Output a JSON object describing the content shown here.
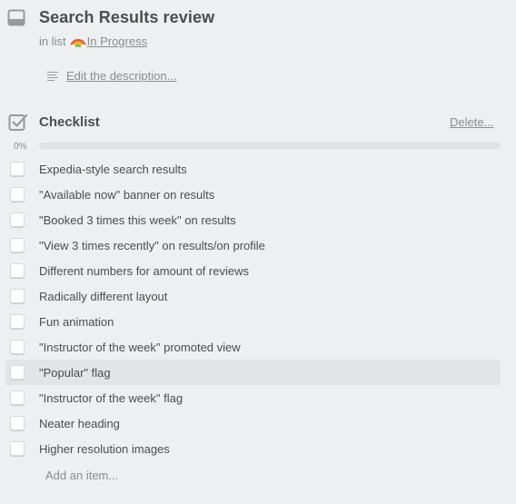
{
  "card": {
    "title": "Search Results review",
    "in_list_prefix": "in list",
    "list_name": "In Progress",
    "edit_description": "Edit the description..."
  },
  "checklist": {
    "title": "Checklist",
    "delete_label": "Delete...",
    "progress_label": "0%",
    "progress": 0,
    "add_item_label": "Add an item...",
    "items": [
      {
        "text": "Expedia-style search results",
        "checked": false
      },
      {
        "text": "\"Available now\" banner on results",
        "checked": false
      },
      {
        "text": "\"Booked 3 times this week\" on results",
        "checked": false
      },
      {
        "text": "\"View 3 times recently\" on results/on profile",
        "checked": false
      },
      {
        "text": "Different numbers for amount of reviews",
        "checked": false
      },
      {
        "text": "Radically different layout",
        "checked": false
      },
      {
        "text": "Fun animation",
        "checked": false
      },
      {
        "text": "\"Instructor of the week\" promoted view",
        "checked": false
      },
      {
        "text": "\"Popular\" flag",
        "checked": false
      },
      {
        "text": "\"Instructor of the week\" flag",
        "checked": false
      },
      {
        "text": "Neater heading",
        "checked": false
      },
      {
        "text": "Higher resolution images",
        "checked": false
      }
    ]
  },
  "icons": {
    "card": "card-icon",
    "rainbow": "rainbow-emoji-icon",
    "description": "description-lines-icon",
    "checklist": "checklist-icon"
  },
  "colors": {
    "background": "#edeff0",
    "progress_track": "#dfe1e3",
    "progress_fill": "#61bd4f"
  }
}
